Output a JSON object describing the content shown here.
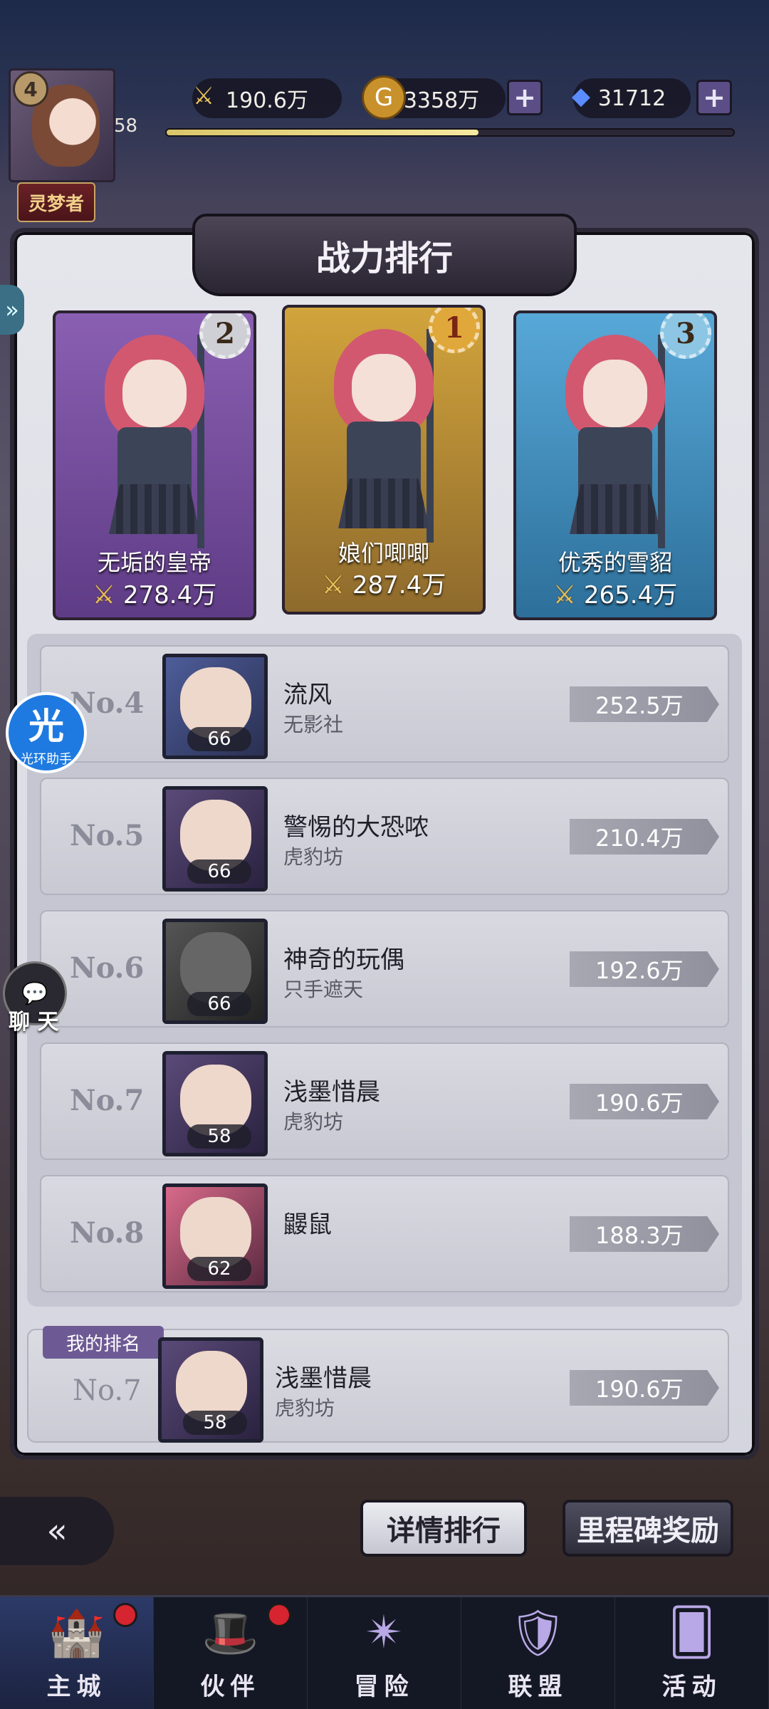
{
  "player": {
    "rank_badge": "4",
    "level": "58",
    "title": "灵梦者",
    "xp_fraction": 0.55
  },
  "resources": {
    "power": "190.6万",
    "gold": "3358万",
    "gems": "31712"
  },
  "panel_title": "战力排行",
  "top3": [
    {
      "rank": "2",
      "name": "无垢的皇帝",
      "power": "278.4万"
    },
    {
      "rank": "1",
      "name": "娘们唧唧",
      "power": "287.4万"
    },
    {
      "rank": "3",
      "name": "优秀的雪貂",
      "power": "265.4万"
    }
  ],
  "rankings": [
    {
      "rank": "No.4",
      "name": "流风",
      "guild": "无影社",
      "level": "66",
      "power": "252.5万"
    },
    {
      "rank": "No.5",
      "name": "警惕的大恐哝",
      "guild": "虎豹坊",
      "level": "66",
      "power": "210.4万"
    },
    {
      "rank": "No.6",
      "name": "神奇的玩偶",
      "guild": "只手遮天",
      "level": "66",
      "power": "192.6万"
    },
    {
      "rank": "No.7",
      "name": "浅墨惜晨",
      "guild": "虎豹坊",
      "level": "58",
      "power": "190.6万"
    },
    {
      "rank": "No.8",
      "name": "鼹鼠",
      "guild": "",
      "level": "62",
      "power": "188.3万"
    }
  ],
  "my_rank": {
    "tag": "我的排名",
    "rank": "No.7",
    "name": "浅墨惜晨",
    "guild": "虎豹坊",
    "level": "58",
    "power": "190.6万"
  },
  "floating": {
    "assistant_glyph": "光",
    "assistant_label": "光环助手",
    "chat_label": "聊 天"
  },
  "buttons": {
    "detail": "详情排行",
    "milestone": "里程碑奖励"
  },
  "nav": [
    {
      "label": "主城"
    },
    {
      "label": "伙伴"
    },
    {
      "label": "冒险"
    },
    {
      "label": "联盟"
    },
    {
      "label": "活动"
    }
  ]
}
